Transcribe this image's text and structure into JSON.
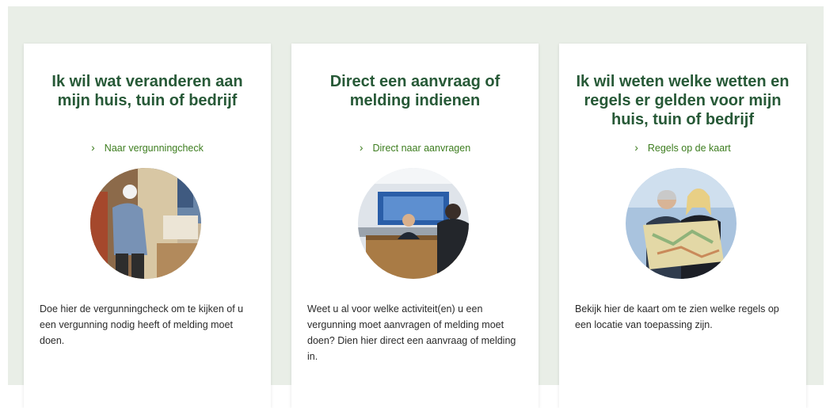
{
  "cards": [
    {
      "title": "Ik wil wat veranderen aan mijn huis, tuin of bedrijf",
      "link_icon": "chevron-right-icon",
      "link_label": "Naar vergunningcheck",
      "text": "Doe hier de vergunningcheck om te kijken of u een vergunning nodig heeft of melding moet doen."
    },
    {
      "title": "Direct een aanvraag of melding indienen",
      "link_icon": "chevron-right-icon",
      "link_label": "Direct naar aanvragen",
      "text": "Weet u al voor welke activiteit(en) u een vergunning moet aanvragen of melding moet doen? Dien hier direct een aanvraag of melding in."
    },
    {
      "title": "Ik wil weten welke wetten en regels er gelden voor mijn huis, tuin of bedrijf",
      "link_icon": "chevron-right-icon",
      "link_label": "Regels op de kaart",
      "text": "Bekijk hier de kaart om te zien welke regels op een locatie van toepassing zijn."
    }
  ],
  "colors": {
    "background": "#e9eee7",
    "title": "#275937",
    "link": "#3d7d1f"
  }
}
